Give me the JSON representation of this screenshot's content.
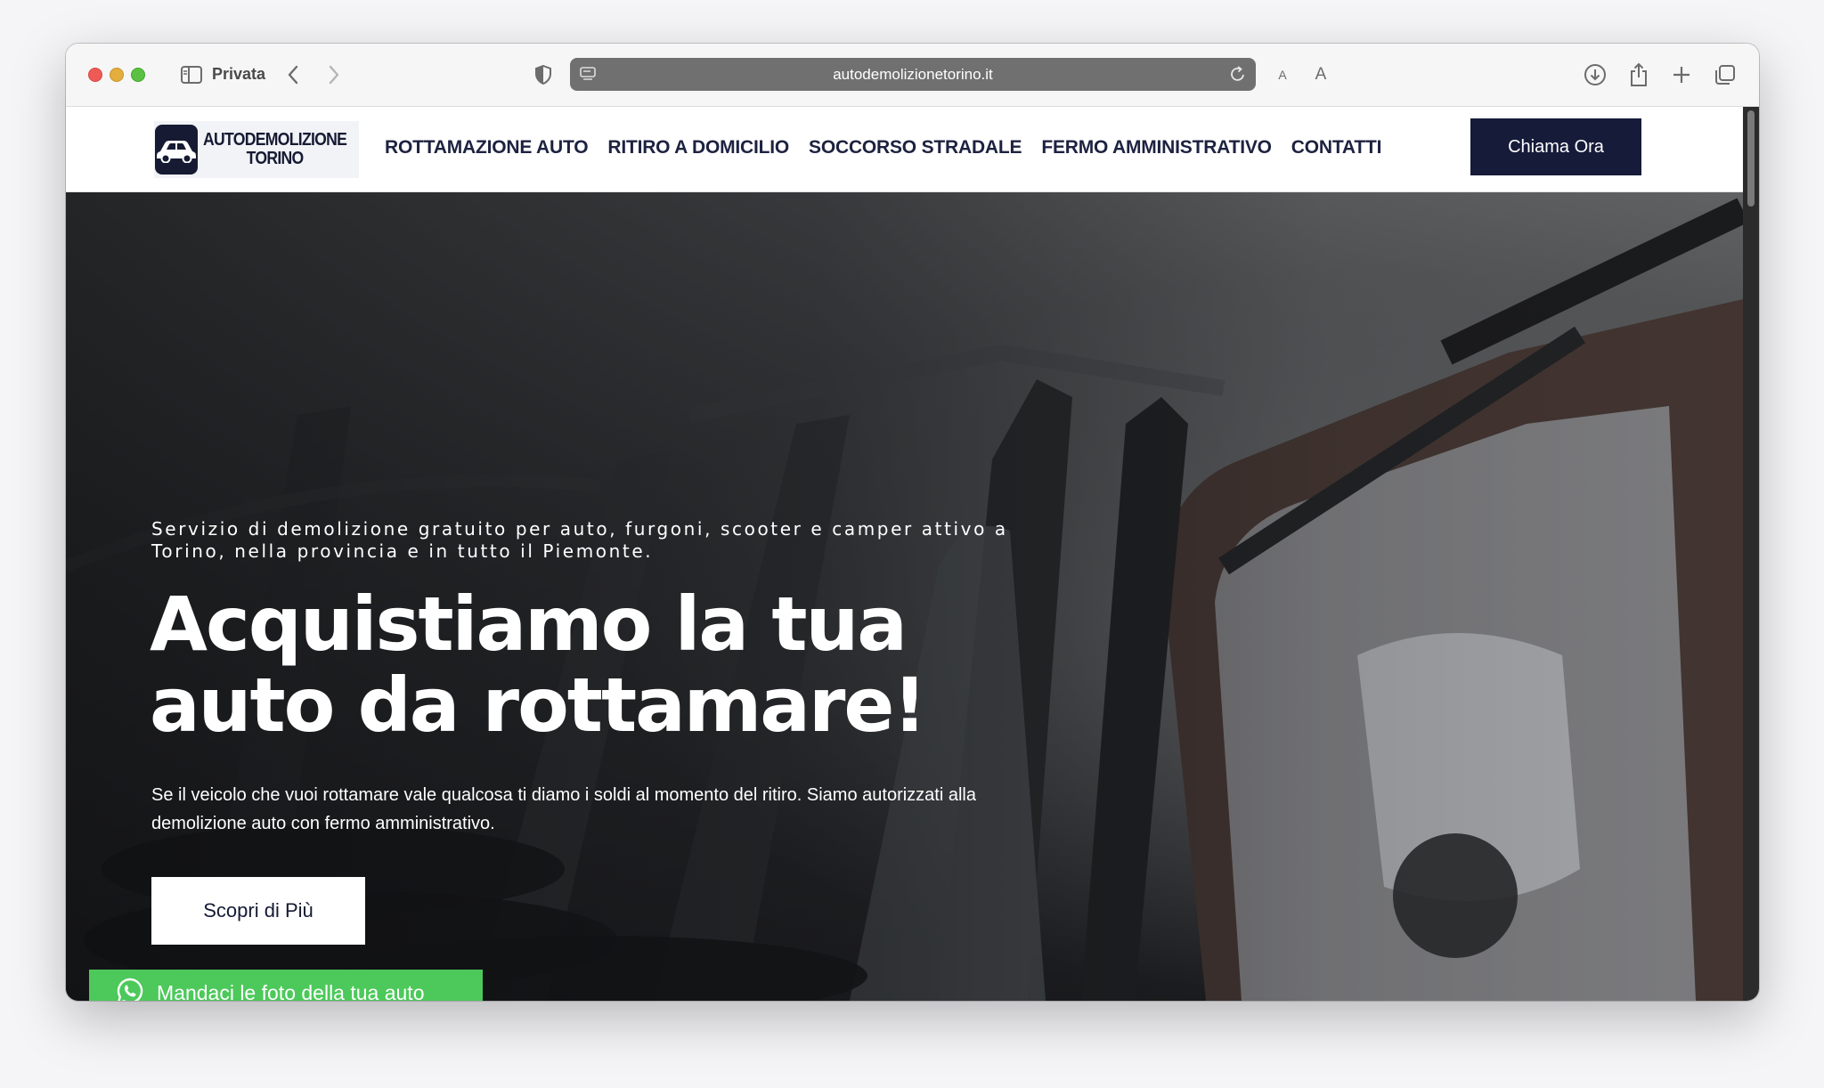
{
  "browser": {
    "private_label": "Privata",
    "url": "autodemolizionetorino.it",
    "font_small": "A",
    "font_large": "A"
  },
  "site": {
    "logo": {
      "line1": "AUTODEMOLIZIONE",
      "line2": "TORINO"
    },
    "nav": [
      {
        "label": "ROTTAMAZIONE AUTO"
      },
      {
        "label": "RITIRO A DOMICILIO"
      },
      {
        "label": "SOCCORSO STRADALE"
      },
      {
        "label": "FERMO AMMINISTRATIVO"
      },
      {
        "label": "CONTATTI"
      }
    ],
    "cta_label": "Chiama Ora",
    "colors": {
      "brand_navy": "#161b3a",
      "whatsapp_green": "#4cc95a"
    }
  },
  "hero": {
    "kicker": "Servizio di demolizione gratuito per auto, furgoni, scooter e camper attivo a Torino, nella provincia e in tutto il Piemonte.",
    "title_line1": "Acquistiamo la tua",
    "title_line2": "auto da rottamare!",
    "description": "Se il veicolo che vuoi rottamare vale qualcosa ti diamo i soldi al momento del ritiro. Siamo autorizzati alla demolizione auto con fermo amministrativo.",
    "button_label": "Scopri di Più"
  },
  "whatsapp": {
    "label": "Mandaci le foto della tua auto",
    "icon": "whatsapp-icon"
  }
}
